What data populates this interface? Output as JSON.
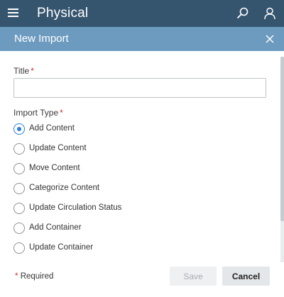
{
  "topbar": {
    "title": "Physical",
    "menu_icon": "hamburger-menu-icon",
    "search_icon": "search-icon",
    "user_icon": "user-icon",
    "background": "#35556f"
  },
  "dialog": {
    "title": "New Import",
    "close_icon": "close-icon",
    "header_background": "#6c9bbf"
  },
  "form": {
    "title_label": "Title",
    "title_value": "",
    "title_placeholder": "",
    "required_marker": "*",
    "import_type_label": "Import Type",
    "import_types": [
      {
        "label": "Add Content",
        "selected": true
      },
      {
        "label": "Update Content",
        "selected": false
      },
      {
        "label": "Move Content",
        "selected": false
      },
      {
        "label": "Categorize Content",
        "selected": false
      },
      {
        "label": "Update Circulation Status",
        "selected": false
      },
      {
        "label": "Add Container",
        "selected": false
      },
      {
        "label": "Update Container",
        "selected": false
      }
    ]
  },
  "footer": {
    "required_note": "Required",
    "required_marker": "*",
    "save_label": "Save",
    "save_disabled": true,
    "cancel_label": "Cancel"
  },
  "colors": {
    "accent": "#2c7ed6",
    "required": "#c7322e"
  }
}
